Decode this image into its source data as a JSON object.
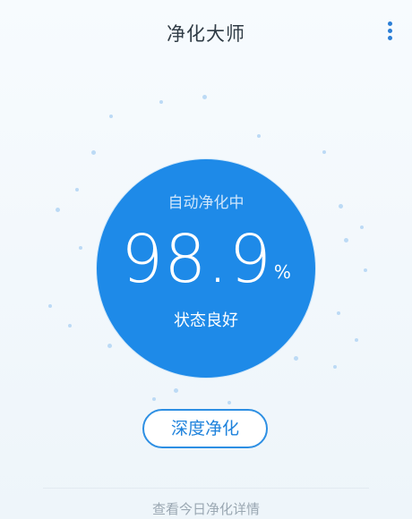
{
  "app": {
    "title": "净化大师"
  },
  "header": {
    "menu_icon": "more-vertical-icon"
  },
  "purifier": {
    "status_top": "自动净化中",
    "percent_value": "98.9",
    "percent_unit": "%",
    "status_bottom": "状态良好"
  },
  "actions": {
    "deep_clean_label": "深度净化",
    "details_link_label": "查看今日净化详情"
  },
  "colors": {
    "accent": "#1e8ae8",
    "title_text": "#2f3b45",
    "link_text": "#9aa7b2"
  }
}
